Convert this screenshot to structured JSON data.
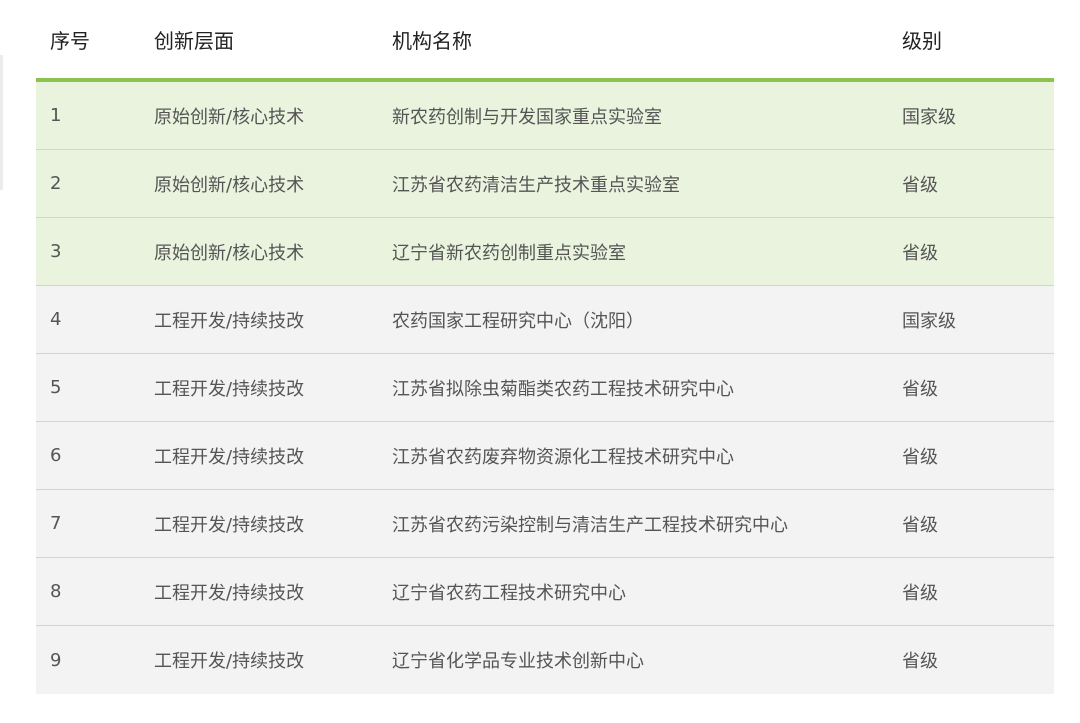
{
  "table": {
    "headers": [
      "序号",
      "创新层面",
      "机构名称",
      "级别"
    ],
    "rows": [
      {
        "no": "1",
        "layer": "原始创新/核心技术",
        "name": "新农药创制与开发国家重点实验室",
        "level": "国家级",
        "tone": "green"
      },
      {
        "no": "2",
        "layer": "原始创新/核心技术",
        "name": "江苏省农药清洁生产技术重点实验室",
        "level": "省级",
        "tone": "green"
      },
      {
        "no": "3",
        "layer": "原始创新/核心技术",
        "name": "辽宁省新农药创制重点实验室",
        "level": "省级",
        "tone": "green"
      },
      {
        "no": "4",
        "layer": "工程开发/持续技改",
        "name": "农药国家工程研究中心（沈阳）",
        "level": "国家级",
        "tone": "gray"
      },
      {
        "no": "5",
        "layer": "工程开发/持续技改",
        "name": "江苏省拟除虫菊酯类农药工程技术研究中心",
        "level": "省级",
        "tone": "gray"
      },
      {
        "no": "6",
        "layer": "工程开发/持续技改",
        "name": "江苏省农药废弃物资源化工程技术研究中心",
        "level": "省级",
        "tone": "gray"
      },
      {
        "no": "7",
        "layer": "工程开发/持续技改",
        "name": "江苏省农药污染控制与清洁生产工程技术研究中心",
        "level": "省级",
        "tone": "gray"
      },
      {
        "no": "8",
        "layer": "工程开发/持续技改",
        "name": "辽宁省农药工程技术研究中心",
        "level": "省级",
        "tone": "gray"
      },
      {
        "no": "9",
        "layer": "工程开发/持续技改",
        "name": "辽宁省化学品专业技术创新中心",
        "level": "省级",
        "tone": "gray"
      }
    ]
  },
  "colors": {
    "accent_line": "#8cc34f",
    "green_row": "#eaf3de",
    "gray_row": "#f3f3f3"
  }
}
